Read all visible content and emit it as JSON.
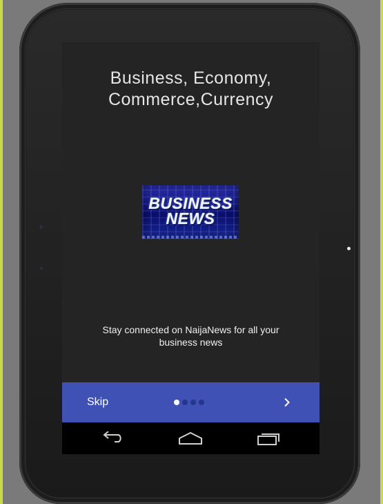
{
  "onboarding": {
    "title": "Business, Economy,\nCommerce,Currency",
    "logo": {
      "line1": "BUSINESS",
      "line2": "NEWS"
    },
    "message": "Stay connected on NaijaNews for all your business news",
    "skip_label": "Skip",
    "page_indicator": {
      "pages": 4,
      "current": 1
    },
    "accent_color": "#3f51b5"
  },
  "system_nav": {
    "back": "back-icon",
    "home": "home-icon",
    "recents": "recents-icon"
  }
}
